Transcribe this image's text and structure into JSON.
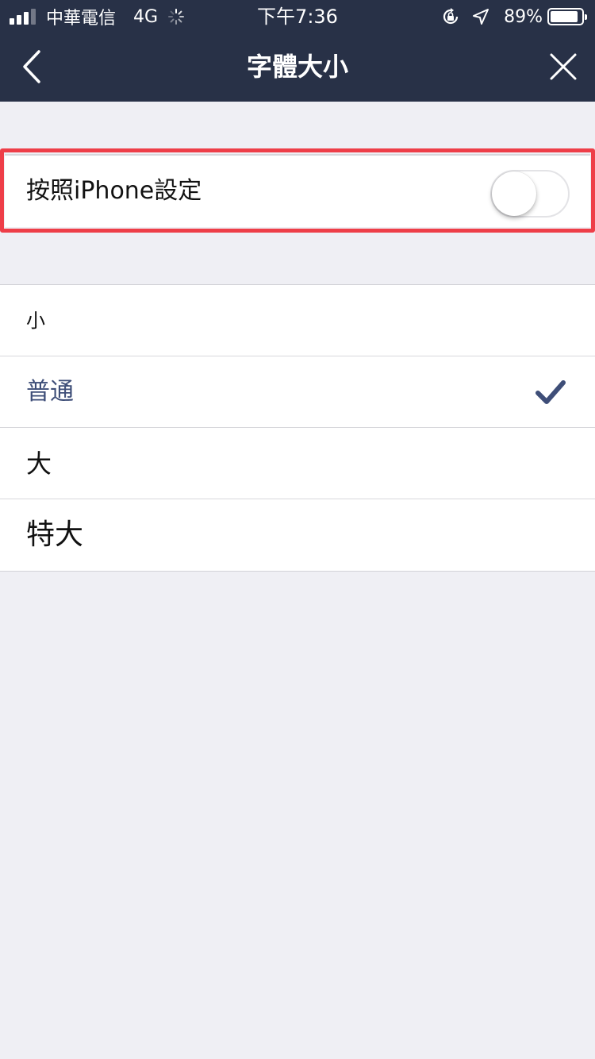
{
  "status_bar": {
    "carrier": "中華電信",
    "network": "4G",
    "time": "下午7:36",
    "battery": "89%",
    "battery_level": 0.89,
    "signal_bars_filled": 3,
    "signal_bars_total": 4
  },
  "nav": {
    "title": "字體大小",
    "back_icon": "chevron-left-icon",
    "close_icon": "close-icon"
  },
  "follow_setting": {
    "label": "按照iPhone設定",
    "enabled": false
  },
  "size_options": [
    {
      "label": "小",
      "selected": false
    },
    {
      "label": "普通",
      "selected": true
    },
    {
      "label": "大",
      "selected": false
    },
    {
      "label": "特大",
      "selected": false
    }
  ],
  "colors": {
    "header_bg": "#283147",
    "page_bg": "#efeff4",
    "selected_text": "#3e4e78",
    "highlight_border": "#ee3e48"
  }
}
